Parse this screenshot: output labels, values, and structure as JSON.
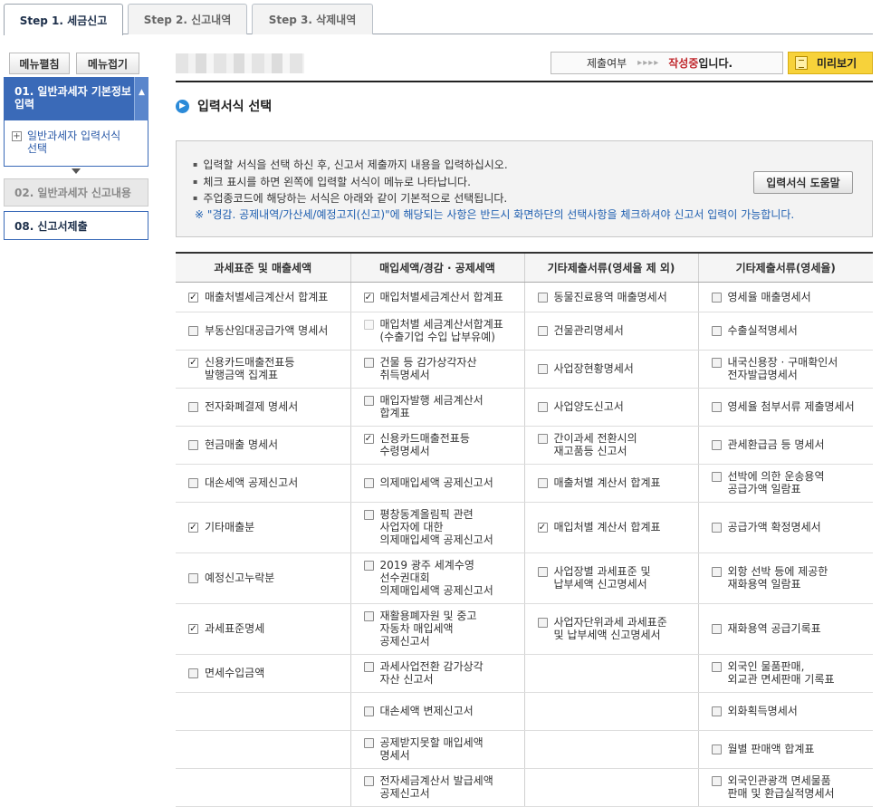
{
  "tabs": [
    {
      "label": "Step 1. 세금신고",
      "active": true
    },
    {
      "label": "Step 2. 신고내역",
      "active": false
    },
    {
      "label": "Step 3. 삭제내역",
      "active": false
    }
  ],
  "sidebar": {
    "expand_label": "메뉴펼침",
    "collapse_label": "메뉴접기",
    "items": [
      {
        "label": "01. 일반과세자 기본정보\n입력",
        "sub": "일반과세자 입력서식\n선택"
      },
      {
        "label": "02. 일반과세자 신고내용"
      },
      {
        "label": "08. 신고서제출"
      }
    ]
  },
  "status": {
    "key": "제출여부",
    "arrows": "▸▸▸▸",
    "value": "작성중",
    "suffix": "입니다.",
    "preview_label": "미리보기"
  },
  "section_title": "입력서식 선택",
  "info": {
    "bullets": [
      "입력할 서식을 선택 하신 후, 신고서 제출까지 내용을 입력하십시오.",
      "체크 표시를 하면 왼쪽에 입력할 서식이 메뉴로 나타납니다.",
      "주업종코드에 해당하는 서식은 아래와 같이 기본적으로 선택됩니다."
    ],
    "note": "※ \"경감. 공제내역/가산세/예정고지(신고)\"에 해당되는 사항은 반드시 화면하단의 선택사항을 체크하셔야 신고서 입력이 가능합니다.",
    "help_button": "입력서식 도움말"
  },
  "table": {
    "headers": [
      "과세표준 및 매출세액",
      "매입세액/경감 · 공제세액",
      "기타제출서류(영세율 제 외)",
      "기타제출서류(영세율)"
    ],
    "rows": [
      {
        "h": 33,
        "cells": [
          {
            "t": "매출처별세금계산서 합계표",
            "c": true
          },
          {
            "t": "매입처별세금계산서 합계표",
            "c": true
          },
          {
            "t": "동물진료용역 매출명세서",
            "c": false
          },
          {
            "t": "영세율 매출명세서",
            "c": false
          }
        ]
      },
      {
        "h": 42,
        "cells": [
          {
            "t": "부동산임대공급가액 명세서",
            "c": false
          },
          {
            "t": "매입처별 세금계산서합계표\n(수출기업 수입 납부유예)",
            "c": false,
            "d": true
          },
          {
            "t": "건물관리명세서",
            "c": false
          },
          {
            "t": "수출실적명세서",
            "c": false
          }
        ]
      },
      {
        "h": 42,
        "cells": [
          {
            "t": "신용카드매출전표등\n발행금액 집계표",
            "c": true
          },
          {
            "t": "건물 등 감가상각자산\n취득명세서",
            "c": false
          },
          {
            "t": "사업장현황명세서",
            "c": false
          },
          {
            "t": "내국신용장 · 구매확인서\n전자발급명세서",
            "c": false
          }
        ]
      },
      {
        "h": 42,
        "cells": [
          {
            "t": "전자화폐결제 명세서",
            "c": false
          },
          {
            "t": "매입자발행 세금계산서\n합계표",
            "c": false
          },
          {
            "t": "사업양도신고서",
            "c": false
          },
          {
            "t": "영세율 첨부서류 제출명세서",
            "c": false
          }
        ]
      },
      {
        "h": 42,
        "cells": [
          {
            "t": "현금매출 명세서",
            "c": false
          },
          {
            "t": "신용카드매출전표등\n수령명세서",
            "c": true
          },
          {
            "t": "간이과세 전환시의\n재고품등 신고서",
            "c": false
          },
          {
            "t": "관세환급금 등 명세서",
            "c": false
          }
        ]
      },
      {
        "h": 42,
        "cells": [
          {
            "t": "대손세액 공제신고서",
            "c": false
          },
          {
            "t": "의제매입세액 공제신고서",
            "c": false
          },
          {
            "t": "매출처별 계산서 합계표",
            "c": false
          },
          {
            "t": "선박에 의한 운송용역\n공급가액 일람표",
            "c": false
          }
        ]
      },
      {
        "h": 56,
        "cells": [
          {
            "t": "기타매출분",
            "c": true
          },
          {
            "t": "평창동계올림픽 관련\n사업자에 대한\n의제매입세액 공제신고서",
            "c": false
          },
          {
            "t": "매입처별 계산서 합계표",
            "c": true
          },
          {
            "t": "공급가액 확정명세서",
            "c": false
          }
        ]
      },
      {
        "h": 56,
        "cells": [
          {
            "t": "예정신고누락분",
            "c": false
          },
          {
            "t": "2019 광주 세계수영\n선수권대회\n의제매입세액 공제신고서",
            "c": false
          },
          {
            "t": "사업장별 과세표준 및\n납부세액 신고명세서",
            "c": false
          },
          {
            "t": "외항 선박 등에 제공한\n재화용역 일람표",
            "c": false
          }
        ]
      },
      {
        "h": 56,
        "cells": [
          {
            "t": "과세표준명세",
            "c": true
          },
          {
            "t": "재활용폐자원 및 중고\n자동차 매입세액\n공제신고서",
            "c": false
          },
          {
            "t": "사업자단위과세 과세표준\n및 납부세액 신고명세서",
            "c": false
          },
          {
            "t": "재화용역 공급기록표",
            "c": false
          }
        ]
      },
      {
        "h": 42,
        "cells": [
          {
            "t": "면세수입금액",
            "c": false
          },
          {
            "t": "과세사업전환 감가상각\n자산 신고서",
            "c": false
          },
          null,
          {
            "t": "외국인 물품판매,\n외교관 면세판매 기록표",
            "c": false
          }
        ]
      },
      {
        "h": 42,
        "cells": [
          null,
          {
            "t": "대손세액 변제신고서",
            "c": false
          },
          null,
          {
            "t": "외화획득명세서",
            "c": false
          }
        ]
      },
      {
        "h": 42,
        "cells": [
          null,
          {
            "t": "공제받지못할 매입세액\n명세서",
            "c": false
          },
          null,
          {
            "t": "월별 판매액 합계표",
            "c": false
          }
        ]
      },
      {
        "h": 42,
        "cells": [
          null,
          {
            "t": "전자세금계산서 발급세액\n공제신고서",
            "c": false
          },
          null,
          {
            "t": "외국인관광객 면세물품\n판매 및 환급실적명세서",
            "c": false
          }
        ]
      }
    ]
  }
}
